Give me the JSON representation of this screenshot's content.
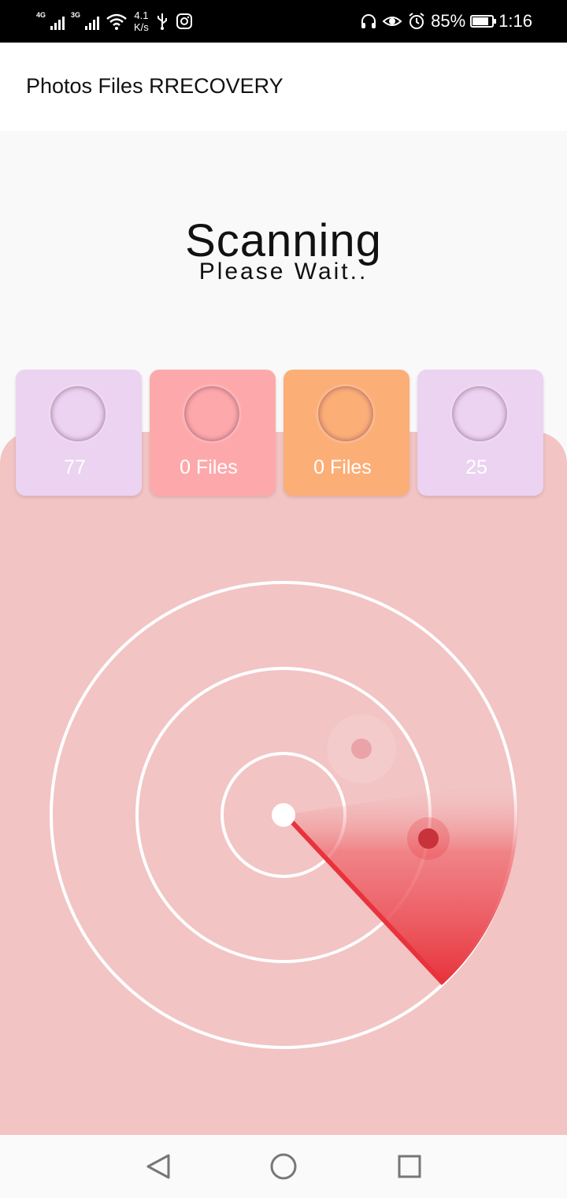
{
  "status_bar": {
    "network1": "4G",
    "network2": "3G",
    "speed_value": "4.1",
    "speed_unit": "K/s",
    "battery": "85%",
    "battery_level": 0.85,
    "time": "1:16"
  },
  "app_bar": {
    "title": "Photos Files RRECOVERY"
  },
  "scan": {
    "title": "Scanning",
    "subtitle": "Please Wait.."
  },
  "cards": [
    {
      "count": "77",
      "color": "#ebd3f1"
    },
    {
      "count": "0 Files",
      "color": "#fda9ab"
    },
    {
      "count": "0 Files",
      "color": "#fcae77"
    },
    {
      "count": "25",
      "color": "#ebd3f1"
    }
  ],
  "radar": {
    "panel_color": "#f2c4c4",
    "sweep_color": "#e8323c"
  },
  "nav": {
    "back_icon": "back-icon",
    "home_icon": "home-icon",
    "recent_icon": "recent-apps-icon"
  }
}
